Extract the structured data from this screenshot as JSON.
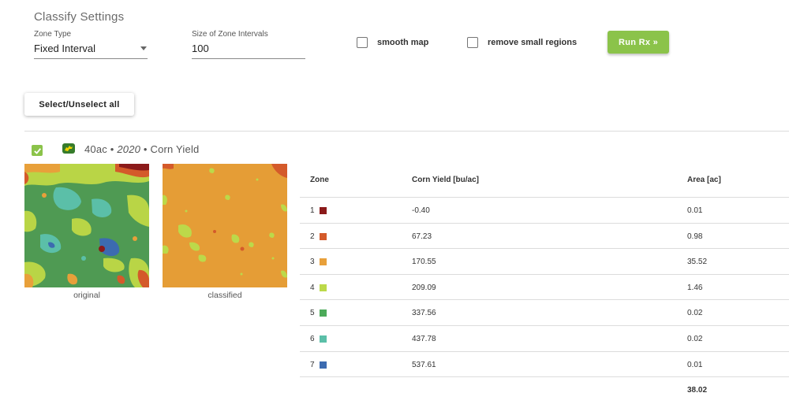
{
  "settings": {
    "title": "Classify Settings",
    "zone_type_label": "Zone Type",
    "zone_type_value": "Fixed Interval",
    "interval_label": "Size of Zone Intervals",
    "interval_value": "100",
    "smooth_map_label": "smooth map",
    "smooth_map_checked": false,
    "remove_small_label": "remove small regions",
    "remove_small_checked": false,
    "run_button": "Run Rx »"
  },
  "select_all_button": "Select/Unselect all",
  "field": {
    "checked": true,
    "acres": "40ac",
    "sep1": " • ",
    "year": "2020",
    "sep2": " • ",
    "layer": "Corn Yield",
    "caption_original": "original",
    "caption_classified": "classified"
  },
  "table": {
    "headers": {
      "zone": "Zone",
      "yield": "Corn Yield [bu/ac]",
      "area": "Area [ac]"
    },
    "rows": [
      {
        "zone": "1",
        "color": "#8b1a1a",
        "yield": "-0.40",
        "area": "0.01"
      },
      {
        "zone": "2",
        "color": "#d45a2a",
        "yield": "67.23",
        "area": "0.98"
      },
      {
        "zone": "3",
        "color": "#e8a03a",
        "yield": "170.55",
        "area": "35.52"
      },
      {
        "zone": "4",
        "color": "#bcd94a",
        "yield": "209.09",
        "area": "1.46"
      },
      {
        "zone": "5",
        "color": "#4caa5a",
        "yield": "337.56",
        "area": "0.02"
      },
      {
        "zone": "6",
        "color": "#5bbfa8",
        "yield": "437.78",
        "area": "0.02"
      },
      {
        "zone": "7",
        "color": "#3c6bb0",
        "yield": "537.61",
        "area": "0.01"
      }
    ],
    "total_area": "38.02"
  },
  "colors": {
    "accent_green": "#8bc34a",
    "deere_green": "#367c2b",
    "classified_base": "#e59d36"
  }
}
